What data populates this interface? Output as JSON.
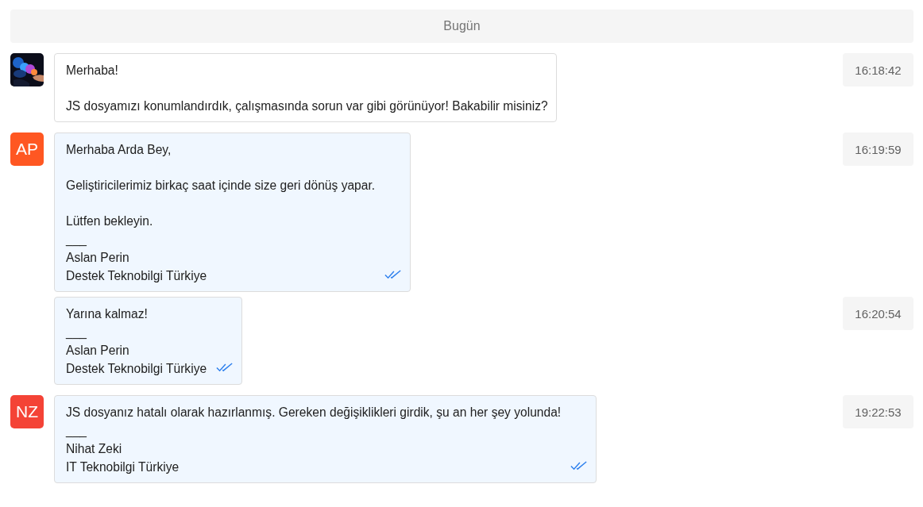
{
  "date_divider": "Bugün",
  "messages": [
    {
      "avatar": {
        "kind": "picture"
      },
      "kind": "incoming",
      "read": false,
      "paragraphs": [
        [
          "Merhaba!"
        ],
        [
          "JS dosyamızı konumlandırdık, çalışmasında sorun var gibi görünüyor! Bakabilir misiniz?"
        ]
      ],
      "time": "16:18:42"
    },
    {
      "avatar": {
        "kind": "initials",
        "initials": "AP",
        "color": "#ff5722"
      },
      "kind": "outgoing",
      "read": true,
      "paragraphs": [
        [
          "Merhaba Arda Bey,"
        ],
        [
          "Geliştiricilerimiz birkaç saat içinde size geri dönüş yapar."
        ],
        [
          "Lütfen bekleyin.",
          "___",
          "Aslan Perin",
          "Destek Teknobilgi Türkiye"
        ]
      ],
      "time": "16:19:59"
    },
    {
      "avatar": {
        "kind": "none"
      },
      "kind": "outgoing",
      "read": true,
      "paragraphs": [
        [
          "Yarına kalmaz!",
          "___",
          "Aslan Perin",
          "Destek Teknobilgi Türkiye"
        ]
      ],
      "time": "16:20:54"
    },
    {
      "avatar": {
        "kind": "initials",
        "initials": "NZ",
        "color": "#f44336"
      },
      "kind": "outgoing",
      "read": true,
      "paragraphs": [
        [
          "JS dosyanız hatalı olarak hazırlanmış. Gereken değişiklikleri girdik, şu an her şey yolunda!",
          "___",
          "Nihat Zeki",
          "IT Teknobilgi Türkiye"
        ]
      ],
      "time": "19:22:53"
    }
  ]
}
